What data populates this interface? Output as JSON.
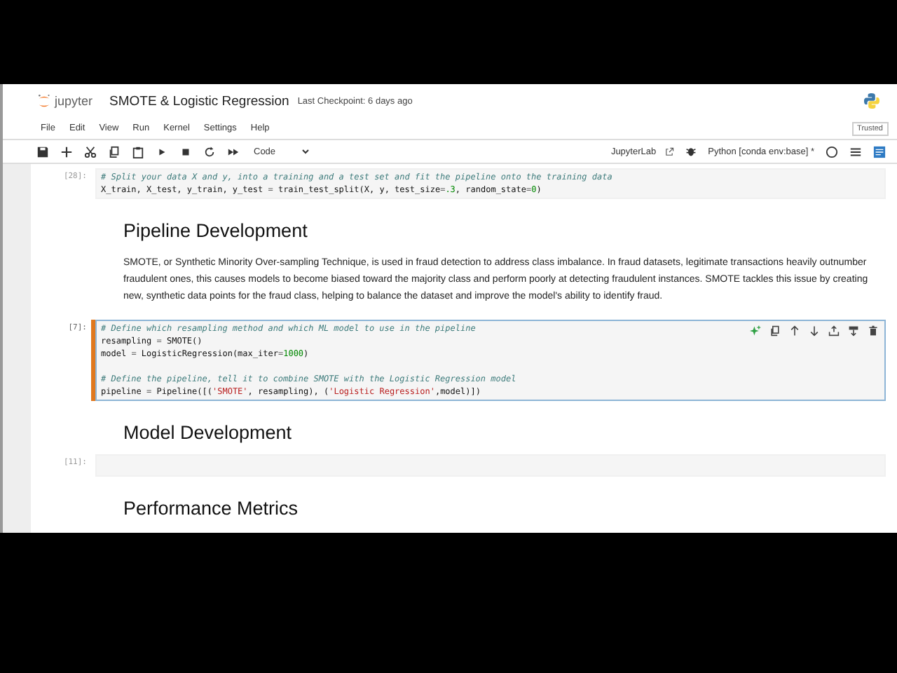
{
  "header": {
    "logo_text": "jupyter",
    "title": "SMOTE & Logistic Regression",
    "checkpoint": "Last Checkpoint: 6 days ago"
  },
  "menu": [
    "File",
    "Edit",
    "View",
    "Run",
    "Kernel",
    "Settings",
    "Help"
  ],
  "trusted": "Trusted",
  "toolbar": {
    "cell_type": "Code",
    "launcher": "JupyterLab",
    "kernel": "Python [conda env:base] *"
  },
  "cells": [
    {
      "kind": "code",
      "prompt": "[28]:",
      "active": false,
      "lines": [
        {
          "tokens": [
            {
              "kind": "comment",
              "text": "# Split your data X and y, into a training and a test set and fit the pipeline onto the training data"
            }
          ]
        },
        {
          "tokens": [
            {
              "kind": "code",
              "text": "X_train, X_test, y_train, y_test "
            },
            {
              "kind": "op",
              "text": "="
            },
            {
              "kind": "code",
              "text": " train_test_split(X, y, test_size"
            },
            {
              "kind": "op",
              "text": "="
            },
            {
              "kind": "number",
              "text": ".3"
            },
            {
              "kind": "code",
              "text": ", random_state"
            },
            {
              "kind": "op",
              "text": "="
            },
            {
              "kind": "number",
              "text": "0"
            },
            {
              "kind": "code",
              "text": ")"
            }
          ]
        }
      ]
    },
    {
      "kind": "heading",
      "text": "Pipeline Development"
    },
    {
      "kind": "paragraph",
      "text": "SMOTE, or Synthetic Minority Over-sampling Technique, is used in fraud detection to address class imbalance. In fraud datasets, legitimate transactions heavily outnumber fraudulent ones, this causes models to become biased toward the majority class and perform poorly at detecting fraudulent instances. SMOTE tackles this issue by creating new, synthetic data points for the fraud class, helping to balance the dataset and improve the model's ability to identify fraud."
    },
    {
      "kind": "code",
      "prompt": "[7]:",
      "active": true,
      "lines": [
        {
          "tokens": [
            {
              "kind": "comment",
              "text": "# Define which resampling method and which ML model to use in the pipeline"
            }
          ]
        },
        {
          "tokens": [
            {
              "kind": "code",
              "text": "resampling "
            },
            {
              "kind": "op",
              "text": "="
            },
            {
              "kind": "code",
              "text": " SMOTE()"
            }
          ]
        },
        {
          "tokens": [
            {
              "kind": "code",
              "text": "model "
            },
            {
              "kind": "op",
              "text": "="
            },
            {
              "kind": "code",
              "text": " LogisticRegression(max_iter"
            },
            {
              "kind": "op",
              "text": "="
            },
            {
              "kind": "number",
              "text": "1000"
            },
            {
              "kind": "code",
              "text": ")"
            }
          ]
        },
        {
          "gap_before": true,
          "tokens": [
            {
              "kind": "comment",
              "text": "# Define the pipeline, tell it to combine SMOTE with the Logistic Regression model"
            }
          ]
        },
        {
          "tokens": [
            {
              "kind": "code",
              "text": "pipeline "
            },
            {
              "kind": "op",
              "text": "="
            },
            {
              "kind": "code",
              "text": " Pipeline([("
            },
            {
              "kind": "string",
              "text": "'SMOTE'"
            },
            {
              "kind": "code",
              "text": ", resampling), ("
            },
            {
              "kind": "string",
              "text": "'Logistic Regression'"
            },
            {
              "kind": "code",
              "text": ",model)])"
            }
          ]
        }
      ]
    },
    {
      "kind": "heading",
      "text": "Model Development"
    },
    {
      "kind": "code",
      "prompt": "[11]:",
      "active": false
    },
    {
      "kind": "heading",
      "text": "Performance Metrics"
    }
  ]
}
